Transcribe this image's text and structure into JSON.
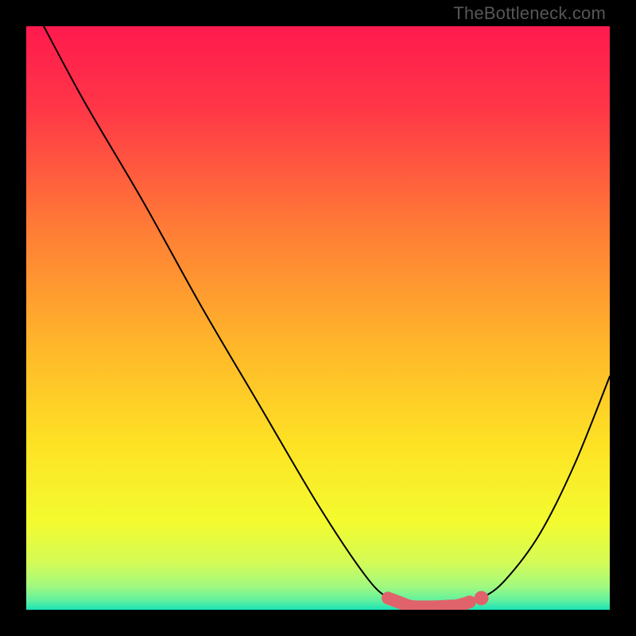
{
  "watermark": "TheBottleneck.com",
  "colors": {
    "gradient_stops": [
      {
        "offset": "0%",
        "color": "#ff1a4e"
      },
      {
        "offset": "14%",
        "color": "#ff3647"
      },
      {
        "offset": "35%",
        "color": "#ff7d36"
      },
      {
        "offset": "55%",
        "color": "#ffb72a"
      },
      {
        "offset": "72%",
        "color": "#fde324"
      },
      {
        "offset": "85%",
        "color": "#f3fb2f"
      },
      {
        "offset": "92%",
        "color": "#d3fb57"
      },
      {
        "offset": "96%",
        "color": "#a0f97f"
      },
      {
        "offset": "98.5%",
        "color": "#5ef0a0"
      },
      {
        "offset": "100%",
        "color": "#18e3b8"
      }
    ],
    "sweet_spot": "#e0636b",
    "curve": "#000000"
  },
  "chart_data": {
    "type": "line",
    "title": "",
    "xlabel": "",
    "ylabel": "",
    "xlim": [
      0,
      100
    ],
    "ylim": [
      0,
      100
    ],
    "series": [
      {
        "name": "bottleneck-curve",
        "x": [
          3,
          10,
          20,
          30,
          40,
          50,
          58,
          62,
          66,
          70,
          74,
          78,
          82,
          88,
          94,
          100
        ],
        "y": [
          100,
          87,
          70,
          52,
          35,
          18,
          6,
          2,
          0.5,
          0.5,
          0.7,
          2,
          5,
          13,
          25,
          40
        ]
      }
    ],
    "sweet_spot_range_x": [
      62,
      76
    ],
    "sweet_spot_dot_x": 78,
    "annotations": []
  }
}
